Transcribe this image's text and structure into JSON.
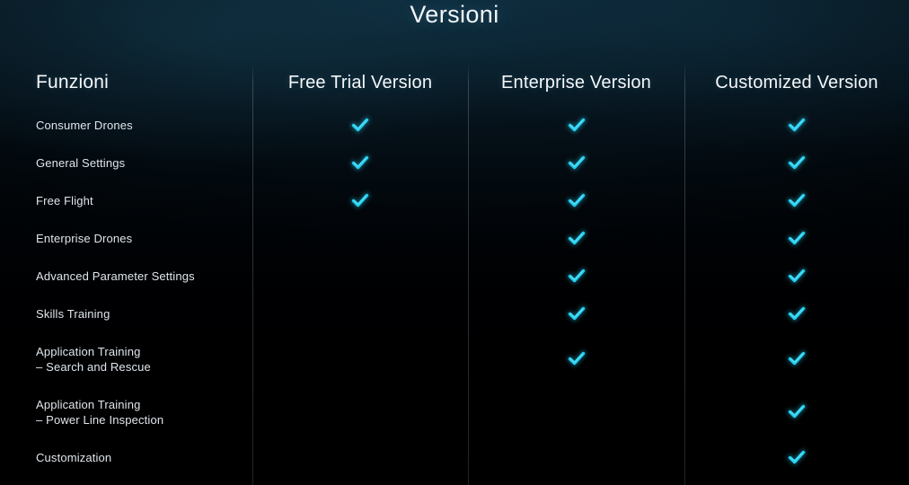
{
  "page": {
    "title": "Versioni",
    "accent_color": "#23cdee",
    "background_top_color": "#0d2230",
    "background_bottom_color": "#000003",
    "text_color": "#dfe6ec",
    "divider_color": "#6c7682"
  },
  "table": {
    "columns": [
      {
        "id": "features",
        "label": "Funzioni"
      },
      {
        "id": "free_trial",
        "label": "Free Trial Version"
      },
      {
        "id": "enterprise",
        "label": "Enterprise Version"
      },
      {
        "id": "customized",
        "label": "Customized Version"
      }
    ],
    "rows": [
      {
        "label": "Consumer Drones",
        "free_trial": "check",
        "enterprise": "check",
        "customized": "check"
      },
      {
        "label": "General Settings",
        "free_trial": "check",
        "enterprise": "check",
        "customized": "check"
      },
      {
        "label": "Free Flight",
        "free_trial": "check",
        "enterprise": "check",
        "customized": "check"
      },
      {
        "label": "Enterprise Drones",
        "free_trial": "",
        "enterprise": "check",
        "customized": "check"
      },
      {
        "label": "Advanced Parameter Settings",
        "free_trial": "",
        "enterprise": "check",
        "customized": "check"
      },
      {
        "label": "Skills Training",
        "free_trial": "",
        "enterprise": "check",
        "customized": "check"
      },
      {
        "label": "Application Training\n– Search and Rescue",
        "free_trial": "",
        "enterprise": "check",
        "customized": "check"
      },
      {
        "label": "Application Training\n– Power Line Inspection",
        "free_trial": "",
        "enterprise": "",
        "customized": "check"
      },
      {
        "label": "Customization",
        "free_trial": "",
        "enterprise": "",
        "customized": "check"
      }
    ]
  },
  "icons": {
    "check": "check-icon"
  }
}
